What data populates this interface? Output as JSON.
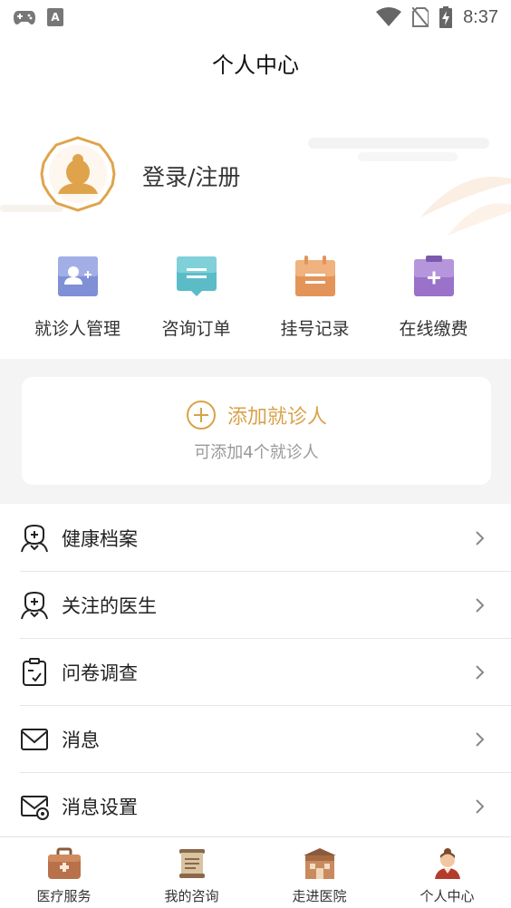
{
  "status_bar": {
    "time": "8:37"
  },
  "header": {
    "title": "个人中心"
  },
  "profile": {
    "login_label": "登录/注册"
  },
  "quick_actions": [
    {
      "label": "就诊人管理",
      "icon": "add-patient-icon",
      "color": "#7e8fd6"
    },
    {
      "label": "咨询订单",
      "icon": "chat-order-icon",
      "color": "#5cbcc7"
    },
    {
      "label": "挂号记录",
      "icon": "register-record-icon",
      "color": "#e49659"
    },
    {
      "label": "在线缴费",
      "icon": "online-payment-icon",
      "color": "#9a72c9"
    }
  ],
  "add_patient": {
    "label": "添加就诊人",
    "sub": "可添加4个就诊人",
    "accent": "#d9a24a"
  },
  "menu": [
    {
      "label": "健康档案",
      "icon": "health-record-icon"
    },
    {
      "label": "关注的医生",
      "icon": "followed-doctor-icon"
    },
    {
      "label": "问卷调查",
      "icon": "survey-icon"
    },
    {
      "label": "消息",
      "icon": "message-icon"
    },
    {
      "label": "消息设置",
      "icon": "message-settings-icon"
    }
  ],
  "bottom_nav": [
    {
      "label": "医疗服务",
      "icon": "medical-kit-icon"
    },
    {
      "label": "我的咨询",
      "icon": "scroll-icon"
    },
    {
      "label": "走进医院",
      "icon": "hospital-icon"
    },
    {
      "label": "个人中心",
      "icon": "person-icon",
      "active": true
    }
  ]
}
